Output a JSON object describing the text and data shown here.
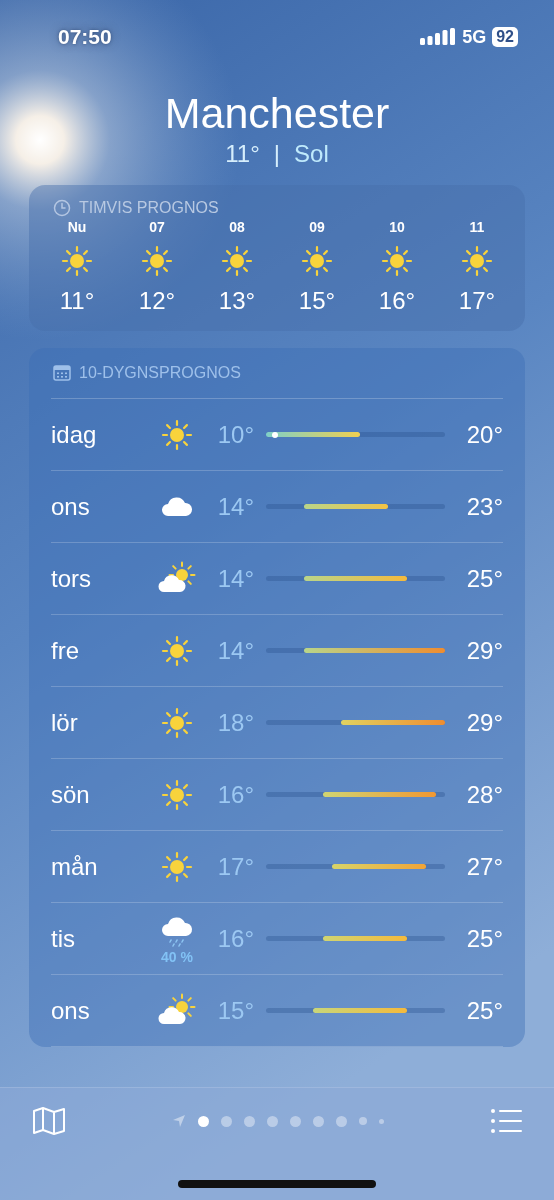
{
  "status_bar": {
    "time": "07:50",
    "network": "5G",
    "battery": "92"
  },
  "header": {
    "city": "Manchester",
    "temperature": "11°",
    "separator": "|",
    "condition": "Sol"
  },
  "hourly": {
    "title": "TIMVIS PROGNOS",
    "hours": [
      {
        "label": "Nu",
        "kind": "sun",
        "temp": "11°"
      },
      {
        "label": "07",
        "kind": "sun",
        "temp": "12°"
      },
      {
        "label": "08",
        "kind": "sun",
        "temp": "13°"
      },
      {
        "label": "09",
        "kind": "sun",
        "temp": "15°"
      },
      {
        "label": "10",
        "kind": "sun",
        "temp": "16°"
      },
      {
        "label": "11",
        "kind": "sun",
        "temp": "17°"
      }
    ]
  },
  "daily": {
    "title": "10-DYGNSPROGNOS",
    "days": [
      {
        "day": "idag",
        "kind": "sun",
        "low": "10°",
        "high": "20°",
        "now_dot": true
      },
      {
        "day": "ons",
        "kind": "cloud",
        "low": "14°",
        "high": "23°",
        "now_dot": false
      },
      {
        "day": "tors",
        "kind": "partly-cloudy",
        "low": "14°",
        "high": "25°",
        "now_dot": false
      },
      {
        "day": "fre",
        "kind": "sun",
        "low": "14°",
        "high": "29°",
        "now_dot": false
      },
      {
        "day": "lör",
        "kind": "sun",
        "low": "18°",
        "high": "29°",
        "now_dot": false
      },
      {
        "day": "sön",
        "kind": "sun",
        "low": "16°",
        "high": "28°",
        "now_dot": false
      },
      {
        "day": "mån",
        "kind": "sun",
        "low": "17°",
        "high": "27°",
        "now_dot": false
      },
      {
        "day": "tis",
        "kind": "rain",
        "precipitation": "40 %",
        "low": "16°",
        "high": "25°",
        "now_dot": false
      },
      {
        "day": "ons",
        "kind": "partly-cloudy",
        "low": "15°",
        "high": "25°",
        "now_dot": false
      }
    ]
  },
  "pages": [
    {
      "kind": "location",
      "selected": false
    },
    {
      "kind": "dot",
      "selected": true
    },
    {
      "kind": "dot",
      "selected": false
    },
    {
      "kind": "dot",
      "selected": false
    },
    {
      "kind": "dot",
      "selected": false
    },
    {
      "kind": "dot",
      "selected": false
    },
    {
      "kind": "dot",
      "selected": false
    },
    {
      "kind": "dot",
      "selected": false
    },
    {
      "kind": "dot-small",
      "selected": false
    },
    {
      "kind": "dot-tiny",
      "selected": false
    }
  ]
}
